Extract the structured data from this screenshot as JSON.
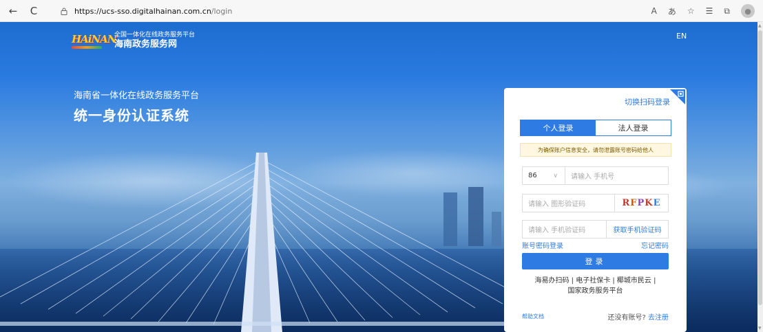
{
  "browser": {
    "back": "←",
    "reload": "C",
    "lock": "🔒",
    "url_host": "https://ucs-sso.digitalhainan.com.cn",
    "url_path": "/login",
    "read_aloud": "A",
    "translate": "あ",
    "favorite": "☆",
    "favorites_list": "☰",
    "collections": "⧉",
    "profile": "●"
  },
  "header": {
    "logo_word": "HAiNAN",
    "logo_line1": "全国一体化在线政务服务平台",
    "logo_line2": "海南政务服务网",
    "lang": "EN"
  },
  "hero": {
    "subtitle": "海南省一体化在线政务服务平台",
    "title": "统一身份认证系统"
  },
  "login": {
    "qr_switch": "切换扫码登录",
    "tabs": [
      "个人登录",
      "法人登录"
    ],
    "notice": "为确保账户信息安全，请勿泄露账号密码给他人",
    "country_code": "86",
    "phone_placeholder": "请输入 手机号",
    "captcha_placeholder": "请输入 图形验证码",
    "captcha_text": "RFPKE",
    "sms_placeholder": "请输入 手机验证码",
    "get_sms": "获取手机验证码",
    "account_login": "账号密码登录",
    "forgot": "忘记密码",
    "submit": "登录",
    "alt_line1": "海易办扫码 | 电子社保卡 | 椰城市民云 |",
    "alt_line2": "国家政务服务平台",
    "help": "帮助文档",
    "no_account": "还没有账号? ",
    "register": "去注册"
  },
  "colors": {
    "accent": "#2f7be4",
    "notice_bg": "#fff7e0"
  }
}
